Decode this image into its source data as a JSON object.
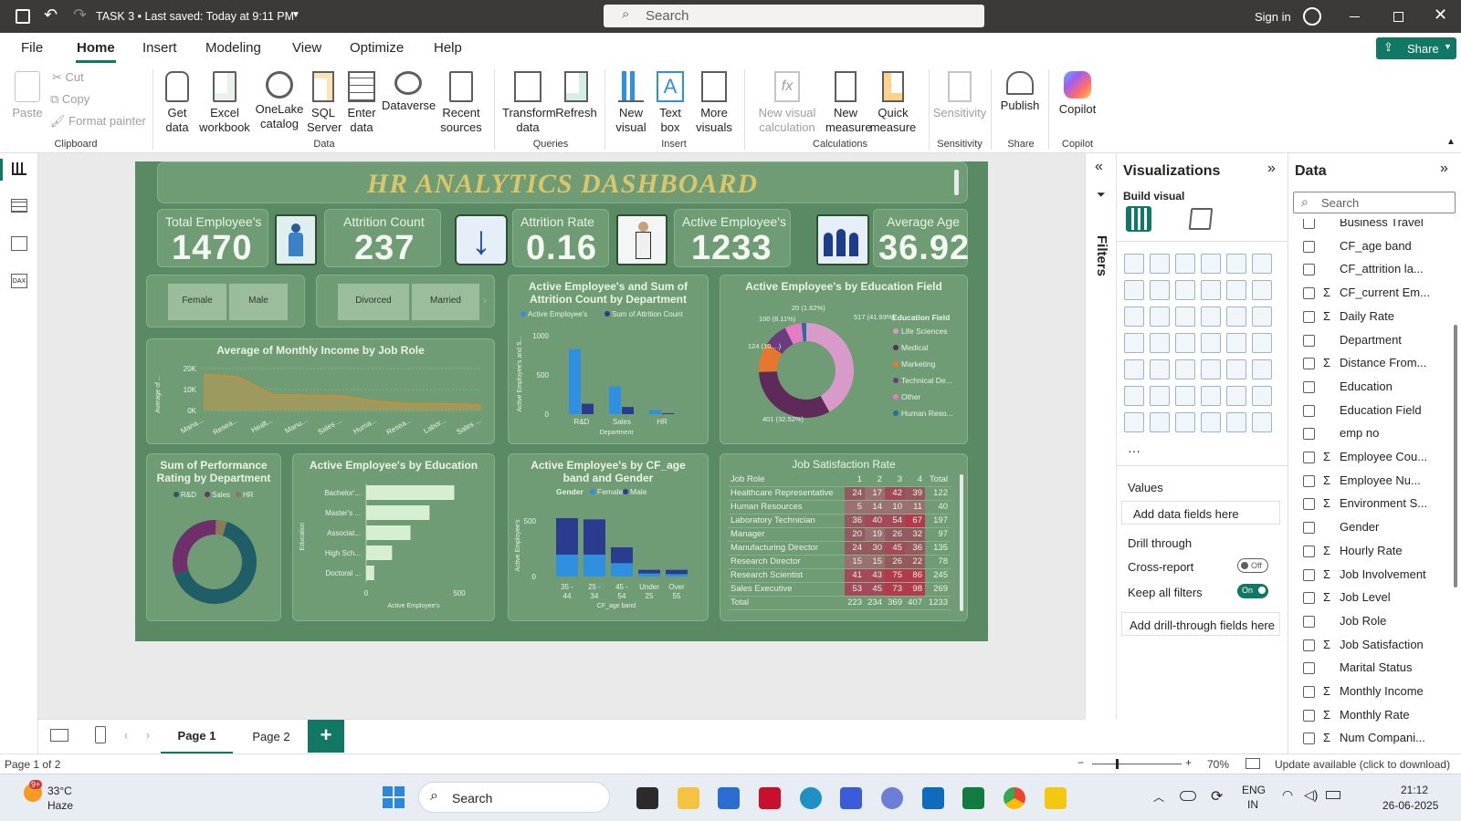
{
  "titlebar": {
    "title": "TASK 3 • Last saved: Today at 9:11 PM",
    "search_placeholder": "Search",
    "signin": "Sign in"
  },
  "menu": [
    "File",
    "Home",
    "Insert",
    "Modeling",
    "View",
    "Optimize",
    "Help"
  ],
  "share_label": "Share",
  "ribbon": {
    "clipboard": {
      "paste": "Paste",
      "cut": "Cut",
      "copy": "Copy",
      "format_painter": "Format painter",
      "group": "Clipboard"
    },
    "data": {
      "get_data": "Get data",
      "excel": "Excel workbook",
      "onelake": "OneLake catalog",
      "sql": "SQL Server",
      "enter": "Enter data",
      "dataverse": "Dataverse",
      "recent": "Recent sources",
      "group": "Data"
    },
    "queries": {
      "transform": "Transform data",
      "refresh": "Refresh",
      "group": "Queries"
    },
    "insert": {
      "new_visual": "New visual",
      "text_box": "Text box",
      "more_visuals": "More visuals",
      "group": "Insert"
    },
    "calculations": {
      "new_visual_calc": "New visual calculation",
      "new_measure": "New measure",
      "quick_measure": "Quick measure",
      "group": "Calculations"
    },
    "sensitivity": {
      "label": "Sensitivity",
      "group": "Sensitivity"
    },
    "share": {
      "publish": "Publish",
      "group": "Share"
    },
    "copilot": {
      "label": "Copilot",
      "group": "Copilot"
    }
  },
  "dashboard": {
    "title": "HR ANALYTICS DASHBOARD",
    "kpis": [
      {
        "label": "Total Employee's",
        "value": "1470"
      },
      {
        "label": "Attrition Count",
        "value": "237"
      },
      {
        "label": "Attrition Rate",
        "value": "0.16"
      },
      {
        "label": "Active Employee's",
        "value": "1233"
      },
      {
        "label": "Average Age",
        "value": "36.92"
      }
    ],
    "slicer_gender": [
      "Female",
      "Male"
    ],
    "slicer_marital": [
      "Divorced",
      "Married"
    ],
    "income_title": "Average of Monthly Income by Job Role",
    "dept_title": "Active Employee's and Sum of Attrition Count by Department",
    "edu_field_title": "Active Employee's by Education Field",
    "perf_title": "Sum of Performance Rating by Department",
    "education_title": "Active Employee's by Education",
    "ageband_title": "Active Employee's by CF_age band and Gender",
    "jobsat_title": "Job Satisfaction Rate"
  },
  "chart_data": [
    {
      "type": "area",
      "title": "Average of Monthly Income by Job Role",
      "ylabel": "Average of ...",
      "categories": [
        "Mana...",
        "Resea...",
        "Healt...",
        "Manu...",
        "Sales ...",
        "Huma...",
        "Resea...",
        "Labor...",
        "Sales ..."
      ],
      "values": [
        17200,
        16000,
        7500,
        7300,
        7000,
        4300,
        3200,
        3200,
        2600
      ],
      "yticks": [
        "20K",
        "10K",
        "0K"
      ],
      "ylim": [
        0,
        20000
      ]
    },
    {
      "type": "bar",
      "title": "Active Employee's and Sum of Attrition Count by Department",
      "categories": [
        "R&D",
        "Sales",
        "HR"
      ],
      "xlabel": "Department",
      "ylabel": "Active Employee's and S...",
      "ylim": [
        0,
        1000
      ],
      "yticks": [
        "1000",
        "500",
        "0"
      ],
      "series": [
        {
          "name": "Active Employee's",
          "values": [
            828,
            354,
            51
          ],
          "color": "#2f8fe0"
        },
        {
          "name": "Sum of Attrition Count",
          "values": [
            133,
            92,
            12
          ],
          "color": "#2b3b8f"
        }
      ]
    },
    {
      "type": "pie",
      "title": "Active Employee's by Education Field",
      "legend_title": "Education Field",
      "series": [
        {
          "name": "Life Sciences",
          "value": 517,
          "label": "517 (41.93%)",
          "color": "#d89ac8"
        },
        {
          "name": "Medical",
          "value": 401,
          "label": "401 (32.52%)",
          "color": "#5e2a5a"
        },
        {
          "name": "Marketing",
          "value": 124,
          "label": "124 (10....)",
          "color": "#e8772e"
        },
        {
          "name": "Technical De...",
          "value": 100,
          "label": "100 (8.11%)",
          "color": "#6a3c7c"
        },
        {
          "name": "Other",
          "value": 71,
          "color": "#e77bc4"
        },
        {
          "name": "Human Reso...",
          "value": 20,
          "label": "20 (1.62%)",
          "color": "#2a6ea0"
        }
      ]
    },
    {
      "type": "pie",
      "title": "Sum of Performance Rating by Department",
      "series": [
        {
          "name": "R&D",
          "value": 3058,
          "color": "#1f5e66"
        },
        {
          "name": "Sales",
          "value": 1424,
          "color": "#6e2f6a"
        },
        {
          "name": "HR",
          "value": 199,
          "color": "#8a7a55"
        }
      ]
    },
    {
      "type": "bar",
      "title": "Active Employee's by Education",
      "orientation": "horizontal",
      "categories": [
        "Bachelor'...",
        "Master's ...",
        "Associat...",
        "High Sch...",
        "Doctoral ..."
      ],
      "values": [
        473,
        340,
        238,
        139,
        43
      ],
      "xlabel": "Active Employee's",
      "ylabel": "Education",
      "xticks": [
        "0",
        "500"
      ],
      "xlim": [
        0,
        500
      ]
    },
    {
      "type": "bar",
      "title": "Active Employee's by CF_age band and Gender",
      "stacked": true,
      "categories": [
        "35 - 44",
        "25 - 34",
        "45 - 54",
        "Under 25",
        "Over 55"
      ],
      "xlabel": "CF_age band",
      "ylabel": "Active Employee's",
      "legend_title": "Gender",
      "yticks": [
        "500",
        "0"
      ],
      "ylim": [
        0,
        600
      ],
      "series": [
        {
          "name": "Female",
          "values": [
            180,
            180,
            110,
            25,
            20
          ],
          "color": "#2f8fe0"
        },
        {
          "name": "Male",
          "values": [
            300,
            290,
            130,
            30,
            35
          ],
          "color": "#2b3b8f"
        }
      ]
    },
    {
      "type": "table",
      "title": "Job Satisfaction Rate",
      "columns": [
        "Job Role",
        "1",
        "2",
        "3",
        "4",
        "Total"
      ],
      "rows": [
        [
          "Healthcare Representative",
          "24",
          "17",
          "42",
          "39",
          "122"
        ],
        [
          "Human Resources",
          "5",
          "14",
          "10",
          "11",
          "40"
        ],
        [
          "Laboratory Technician",
          "36",
          "40",
          "54",
          "67",
          "197"
        ],
        [
          "Manager",
          "20",
          "19",
          "26",
          "32",
          "97"
        ],
        [
          "Manufacturing Director",
          "24",
          "30",
          "45",
          "36",
          "135"
        ],
        [
          "Research Director",
          "15",
          "15",
          "26",
          "22",
          "78"
        ],
        [
          "Research Scientist",
          "41",
          "43",
          "75",
          "86",
          "245"
        ],
        [
          "Sales Executive",
          "53",
          "45",
          "73",
          "98",
          "269"
        ],
        [
          "Total",
          "223",
          "234",
          "369",
          "407",
          "1233"
        ]
      ]
    }
  ],
  "filters_label": "Filters",
  "viz": {
    "title": "Visualizations",
    "build_visual": "Build visual",
    "values": "Values",
    "add_data": "Add data fields here",
    "drill_through": "Drill through",
    "cross_report": "Cross-report",
    "cross_report_state": "Off",
    "keep_filters": "Keep all filters",
    "keep_filters_state": "On",
    "add_drill": "Add drill-through fields here"
  },
  "data_pane": {
    "title": "Data",
    "search_placeholder": "Search",
    "fields": [
      {
        "name": "Business Travel",
        "sigma": false
      },
      {
        "name": "CF_age band",
        "sigma": false
      },
      {
        "name": "CF_attrition la...",
        "sigma": false
      },
      {
        "name": "CF_current Em...",
        "sigma": true
      },
      {
        "name": "Daily Rate",
        "sigma": true
      },
      {
        "name": "Department",
        "sigma": false
      },
      {
        "name": "Distance From...",
        "sigma": true
      },
      {
        "name": "Education",
        "sigma": false
      },
      {
        "name": "Education Field",
        "sigma": false
      },
      {
        "name": "emp no",
        "sigma": false
      },
      {
        "name": "Employee Cou...",
        "sigma": true
      },
      {
        "name": "Employee Nu...",
        "sigma": true
      },
      {
        "name": "Environment S...",
        "sigma": true
      },
      {
        "name": "Gender",
        "sigma": false
      },
      {
        "name": "Hourly Rate",
        "sigma": true
      },
      {
        "name": "Job Involvement",
        "sigma": true
      },
      {
        "name": "Job Level",
        "sigma": true
      },
      {
        "name": "Job Role",
        "sigma": false
      },
      {
        "name": "Job Satisfaction",
        "sigma": true
      },
      {
        "name": "Marital Status",
        "sigma": false
      },
      {
        "name": "Monthly Income",
        "sigma": true
      },
      {
        "name": "Monthly Rate",
        "sigma": true
      },
      {
        "name": "Num Compani...",
        "sigma": true
      }
    ]
  },
  "pages": {
    "page1": "Page 1",
    "page2": "Page 2",
    "add": "+"
  },
  "status": {
    "page": "Page 1 of 2",
    "zoom": "70%",
    "update": "Update available (click to download)"
  },
  "taskbar": {
    "temp": "33°C",
    "weather": "Haze",
    "search": "Search",
    "lang1": "ENG",
    "lang2": "IN",
    "time": "21:12",
    "date": "26-06-2025",
    "badge": "9+"
  }
}
